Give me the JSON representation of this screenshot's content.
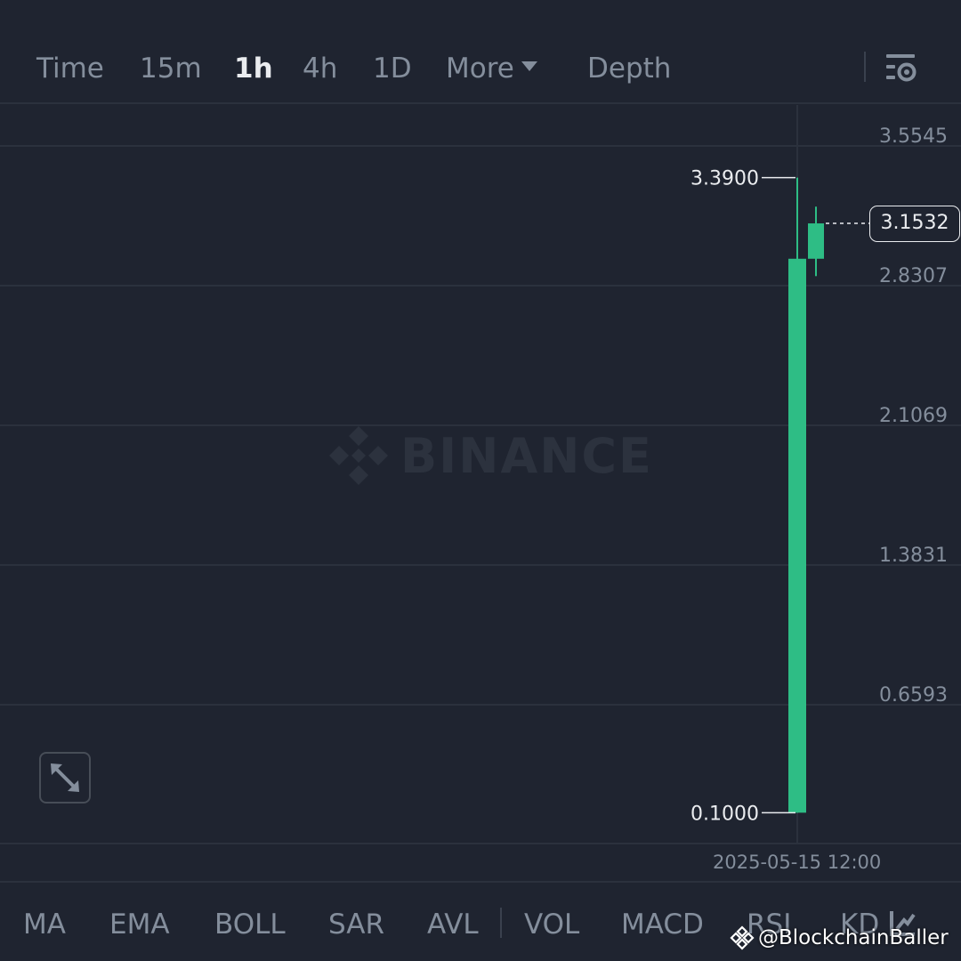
{
  "toolbar": {
    "timeframes": [
      {
        "label": "Time",
        "active": false
      },
      {
        "label": "15m",
        "active": false
      },
      {
        "label": "1h",
        "active": true
      },
      {
        "label": "4h",
        "active": false
      },
      {
        "label": "1D",
        "active": false
      },
      {
        "label": "More",
        "active": false
      },
      {
        "label": "Depth",
        "active": false
      }
    ],
    "settings_icon": "chart-settings-icon"
  },
  "chart": {
    "watermark": "BINANCE",
    "price_axis": [
      "3.5545",
      "2.8307",
      "2.1069",
      "1.3831",
      "0.6593"
    ],
    "high_label": "3.3900",
    "low_label": "0.1000",
    "current_price": "3.1532",
    "date_label": "2025-05-15 12:00",
    "expand_icon": "expand-arrows-icon",
    "up_color": "#2ebd85",
    "background_color": "#1f2430"
  },
  "chart_data": {
    "type": "candlestick",
    "y_ticks": [
      3.5545,
      2.8307,
      2.1069,
      1.3831,
      0.6593
    ],
    "candles": [
      {
        "open": 0.1,
        "high": 3.39,
        "low": 0.1,
        "close": 2.97
      },
      {
        "open": 2.97,
        "high": 3.24,
        "low": 2.88,
        "close": 3.1532
      }
    ],
    "x_label": "2025-05-15 12:00"
  },
  "indicators": [
    "MA",
    "EMA",
    "BOLL",
    "SAR",
    "AVL",
    "VOL",
    "MACD",
    "RSI",
    "KD"
  ],
  "credit": "@BlockchainBaller"
}
